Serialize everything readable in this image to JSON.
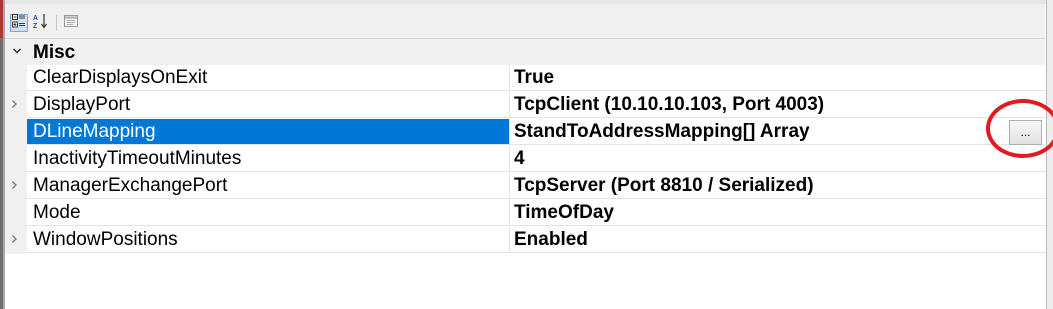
{
  "toolbar": {
    "buttons": [
      {
        "icon": "categorized-icon",
        "pressed": true
      },
      {
        "icon": "alphabetical-sort-icon",
        "pressed": false,
        "glyph": "AZ"
      },
      {
        "icon": "property-pages-icon",
        "pressed": false
      }
    ]
  },
  "grid": {
    "category": {
      "label": "Misc",
      "expanded": true
    },
    "rows": [
      {
        "name": "ClearDisplaysOnExit",
        "value": "True",
        "expandable": false,
        "selected": false
      },
      {
        "name": "DisplayPort",
        "value": "TcpClient (10.10.10.103, Port 4003)",
        "expandable": true,
        "selected": false
      },
      {
        "name": "DLineMapping",
        "value": "StandToAddressMapping[] Array",
        "expandable": false,
        "selected": true,
        "has_ellipsis": true,
        "ellipsis_label": "..."
      },
      {
        "name": "InactivityTimeoutMinutes",
        "value": "4",
        "expandable": false,
        "selected": false
      },
      {
        "name": "ManagerExchangePort",
        "value": "TcpServer (Port 8810 / Serialized)",
        "expandable": true,
        "selected": false
      },
      {
        "name": "Mode",
        "value": "TimeOfDay",
        "expandable": false,
        "selected": false
      },
      {
        "name": "WindowPositions",
        "value": "Enabled",
        "expandable": true,
        "selected": false
      }
    ]
  },
  "colors": {
    "selection": "#0078d7",
    "annotation": "#e11b22",
    "category_bg": "#f0f0f0"
  }
}
